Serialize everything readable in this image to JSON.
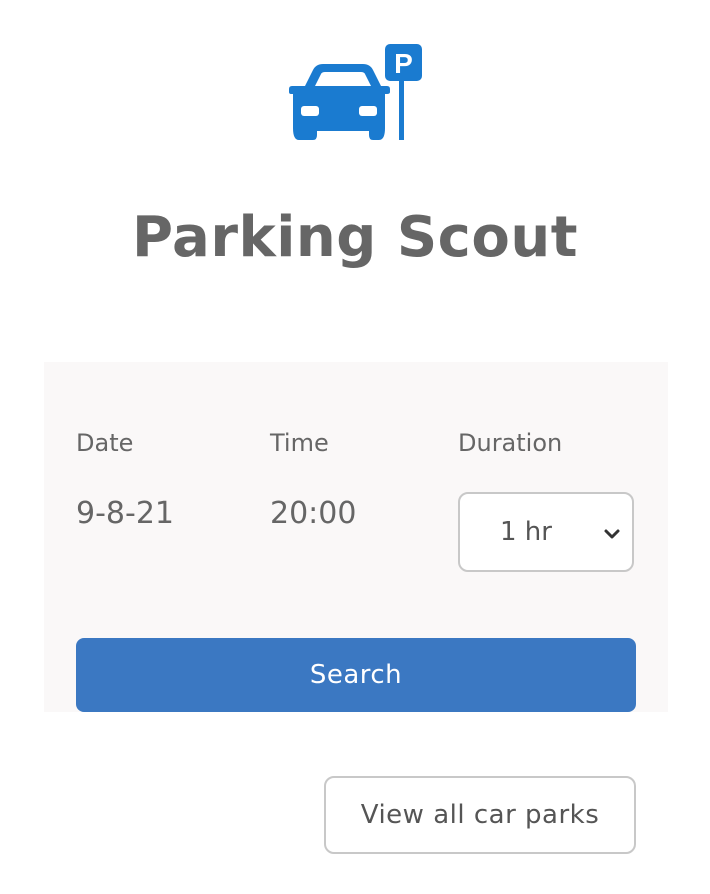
{
  "app": {
    "title": "Parking Scout",
    "logo_icon": "car-parking-icon",
    "accent_color": "#1a7bd0",
    "button_color": "#3b78c2"
  },
  "search_form": {
    "date_label": "Date",
    "time_label": "Time",
    "duration_label": "Duration",
    "date_value": "9-8-21",
    "time_value": "20:00",
    "duration_value": "1 hr",
    "duration_dropdown_icon": "chevron-down-icon",
    "search_label": "Search"
  },
  "footer": {
    "view_all_label": "View all car parks"
  }
}
